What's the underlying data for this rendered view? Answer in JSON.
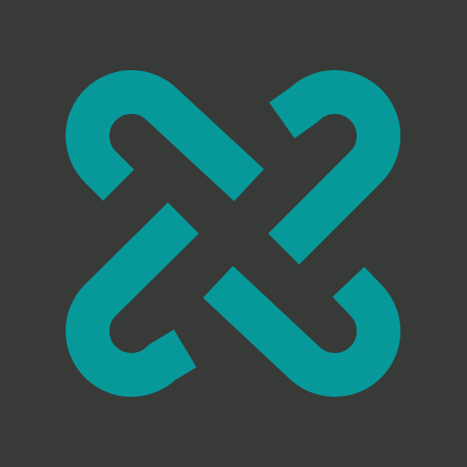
{
  "logo": {
    "icon": "interlaced-knot-logo-icon",
    "colors": {
      "background": "#383a38",
      "band": "#07999a"
    }
  }
}
